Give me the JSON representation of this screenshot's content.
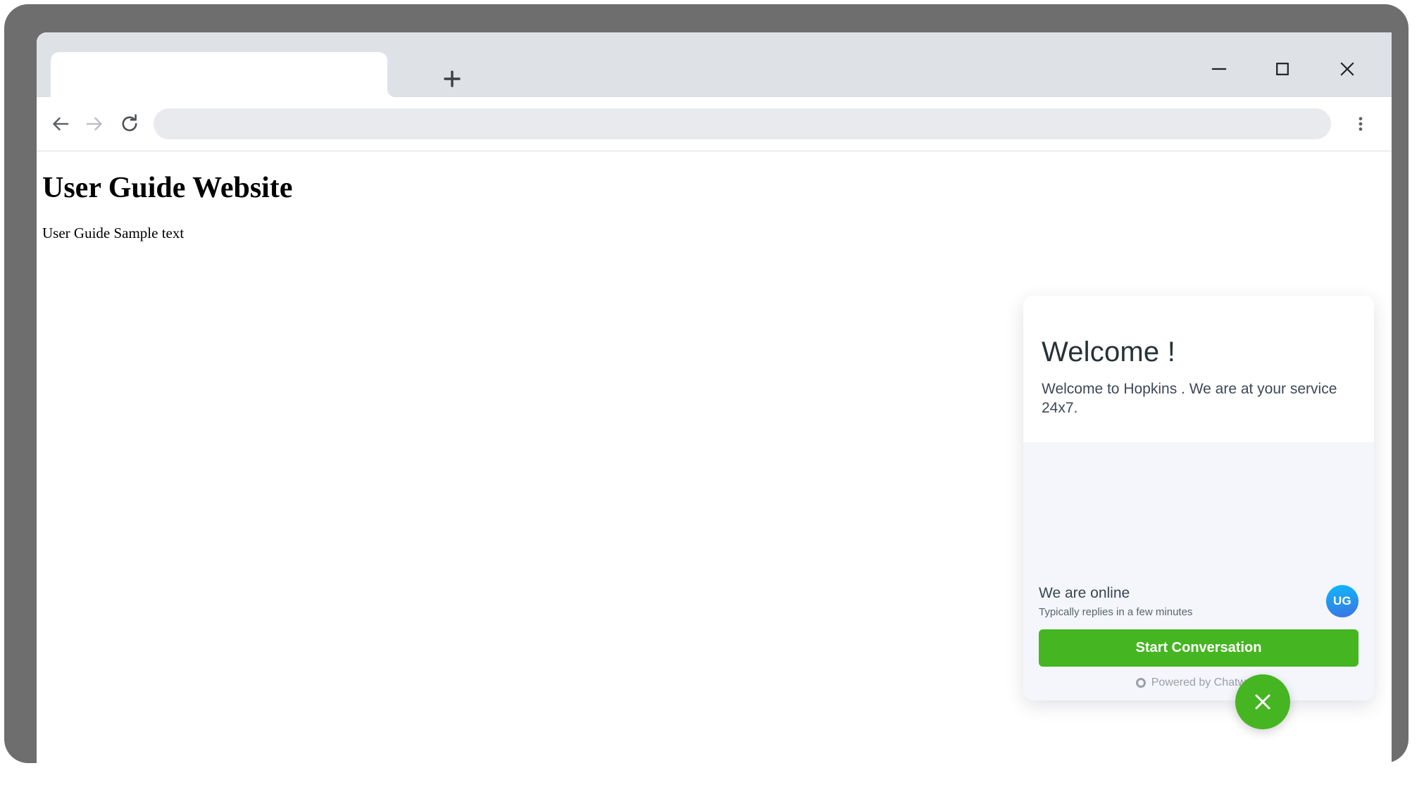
{
  "browser": {
    "tab": {
      "title": "",
      "new_tab_label": "+"
    },
    "window_controls": {
      "minimize": "minimize-icon",
      "maximize": "maximize-icon",
      "close": "close-icon"
    },
    "toolbar": {
      "back": "arrow-left-icon",
      "forward": "arrow-right-icon",
      "reload": "reload-icon",
      "menu": "three-dots-vertical-icon",
      "address_value": "",
      "address_placeholder": ""
    }
  },
  "page": {
    "title": "User Guide Website",
    "paragraph": "User Guide Sample text"
  },
  "chat_widget": {
    "heading": "Welcome !",
    "subheading": "Welcome to Hopkins . We are at your service 24x7.",
    "availability_status": "We are online",
    "reply_time": "Typically replies in a few minutes",
    "agent_avatar_initials": "UG",
    "start_conversation_label": "Start Conversation",
    "powered_by": "Powered by Chatwoot",
    "powered_by_icon": "chatwoot-ring-icon",
    "toggle_icon": "close-icon",
    "colors": {
      "brand_green": "#46b522",
      "header_background": "#ffffff",
      "body_background": "#f4f6fb",
      "heading_text": "#263238",
      "avatar_gradient_start": "#0db9fb",
      "avatar_gradient_end": "#3c72e2",
      "muted_text": "#9aa0a8"
    }
  }
}
